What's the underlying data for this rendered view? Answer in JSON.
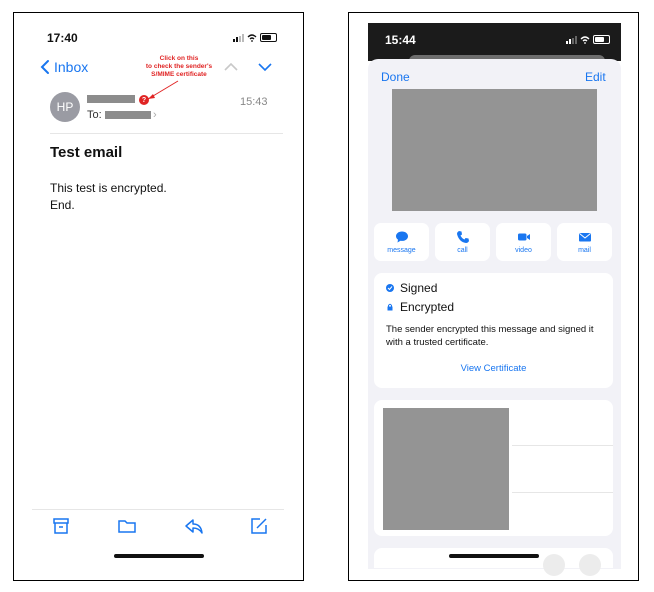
{
  "left": {
    "status_time": "17:40",
    "back_label": "Inbox",
    "annotation": [
      "Click on this",
      "to check the sender's",
      "S/MIME certificate"
    ],
    "avatar_initials": "HP",
    "badge": "?",
    "received_time": "15:43",
    "to_label": "To:",
    "subject": "Test email",
    "body_lines": [
      "This test is encrypted.",
      "End."
    ],
    "toolbar_icons": [
      "archive-icon",
      "folder-icon",
      "reply-icon",
      "compose-icon"
    ]
  },
  "right": {
    "status_time": "15:44",
    "done_label": "Done",
    "edit_label": "Edit",
    "actions": [
      {
        "label": "message",
        "icon": "message-icon"
      },
      {
        "label": "call",
        "icon": "phone-icon"
      },
      {
        "label": "video",
        "icon": "video-icon"
      },
      {
        "label": "mail",
        "icon": "mail-icon"
      }
    ],
    "signed_label": "Signed",
    "encrypted_label": "Encrypted",
    "description": "The sender encrypted this message and signed it with a trusted certificate.",
    "view_certificate_label": "View Certificate"
  },
  "colors": {
    "accent": "#1976f0",
    "annotation_red": "#e02424",
    "redaction_gray": "#8c8c8c",
    "sheet_background": "#f2f2f7"
  }
}
